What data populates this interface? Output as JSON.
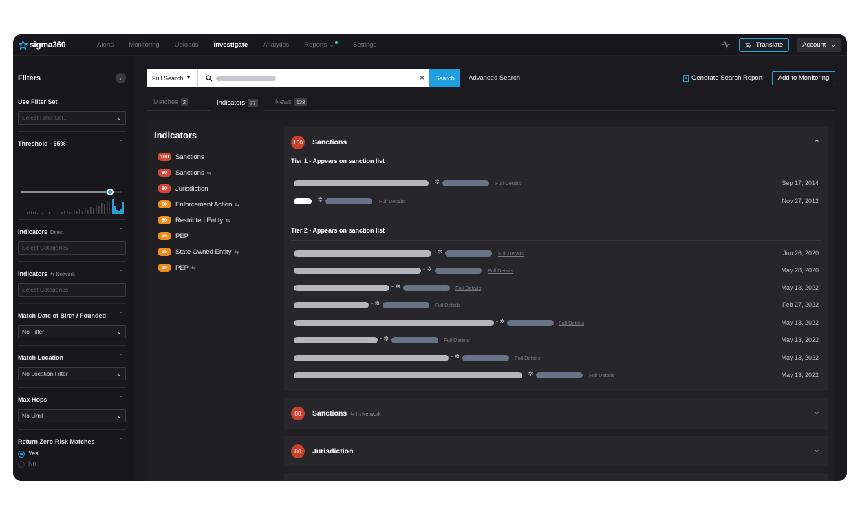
{
  "brand": {
    "name": "sigma360"
  },
  "nav": {
    "items": [
      "Alerts",
      "Monitoring",
      "Uploads",
      "Investigate",
      "Analytics",
      "Reports",
      "Settings"
    ],
    "active": "Investigate",
    "translate_label": "Translate",
    "account_label": "Account"
  },
  "sidebar": {
    "title": "Filters",
    "filter_set": {
      "label": "Use Filter Set",
      "placeholder": "Select Filter Set..."
    },
    "threshold": {
      "label": "Threshold - 95%",
      "value_percent": 95
    },
    "indicators_direct": {
      "label": "Indicators",
      "sub": "Direct",
      "placeholder": "Select Categories"
    },
    "indicators_network": {
      "label": "Indicators",
      "sub": "Network",
      "placeholder": "Select Categories"
    },
    "match_dob": {
      "label": "Match Date of Birth / Founded",
      "value": "No Filter"
    },
    "match_location": {
      "label": "Match Location",
      "value": "No Location Filter"
    },
    "max_hops": {
      "label": "Max Hops",
      "value": "No Limit"
    },
    "zero_risk": {
      "label": "Return Zero-Risk Matches",
      "options": [
        "Yes",
        "No"
      ],
      "selected": "Yes"
    }
  },
  "search": {
    "type": "Full Search",
    "button": "Search",
    "advanced": "Advanced Search",
    "generate_report": "Generate Search Report",
    "add_monitoring": "Add to Monitoring"
  },
  "tabs": [
    {
      "label": "Matches",
      "count": "2"
    },
    {
      "label": "Indicators",
      "count": "77"
    },
    {
      "label": "News",
      "count": "133"
    }
  ],
  "indicators": {
    "title": "Indicators",
    "items": [
      {
        "score": "100",
        "label": "Sanctions",
        "color": "red",
        "network": false
      },
      {
        "score": "80",
        "label": "Sanctions",
        "color": "red",
        "network": true
      },
      {
        "score": "80",
        "label": "Jurisdiction",
        "color": "red",
        "network": false
      },
      {
        "score": "60",
        "label": "Enforcement Action",
        "color": "orange",
        "network": true
      },
      {
        "score": "60",
        "label": "Restricted Entity",
        "color": "orange",
        "network": true
      },
      {
        "score": "40",
        "label": "PEP",
        "color": "orange",
        "network": false
      },
      {
        "score": "15",
        "label": "State Owned Entity",
        "color": "orange",
        "network": true
      },
      {
        "score": "10",
        "label": "PEP",
        "color": "orange",
        "network": true
      }
    ]
  },
  "panels": {
    "sanctions": {
      "score": "100",
      "title": "Sanctions",
      "full_details": "Full Details",
      "tier1": {
        "label": "Tier 1 - Appears on sanction list",
        "records": [
          {
            "date": "Sep 17, 2014"
          },
          {
            "date": "Nov 27, 2012"
          }
        ]
      },
      "tier2": {
        "label": "Tier 2 - Appears on sanction list",
        "records": [
          {
            "date": "Jun 26, 2020"
          },
          {
            "date": "May 28, 2020"
          },
          {
            "date": "May 13, 2022"
          },
          {
            "date": "Feb 27, 2022"
          },
          {
            "date": "May 13, 2022"
          },
          {
            "date": "May 13, 2022"
          },
          {
            "date": "May 13, 2022"
          },
          {
            "date": "May 13, 2022"
          }
        ]
      }
    },
    "sanctions_network": {
      "score": "80",
      "title": "Sanctions",
      "sub": "In Network"
    },
    "jurisdiction": {
      "score": "80",
      "title": "Jurisdiction"
    }
  }
}
